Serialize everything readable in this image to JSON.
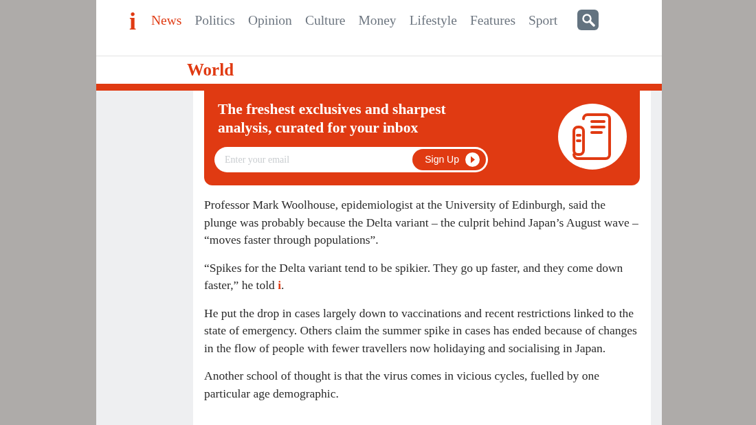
{
  "logo": "i",
  "nav": [
    {
      "label": "News",
      "selected": true
    },
    {
      "label": "Politics",
      "selected": false
    },
    {
      "label": "Opinion",
      "selected": false
    },
    {
      "label": "Culture",
      "selected": false
    },
    {
      "label": "Money",
      "selected": false
    },
    {
      "label": "Lifestyle",
      "selected": false
    },
    {
      "label": "Features",
      "selected": false
    },
    {
      "label": "Sport",
      "selected": false
    }
  ],
  "section": "World",
  "promo": {
    "headline": "The freshest exclusives and sharpest analysis, curated for your inbox",
    "email": {
      "placeholder": "Enter your email"
    },
    "button": "Sign Up"
  },
  "paragraphs": [
    "Professor Mark Woolhouse, epidemiologist at the University of Edinburgh, said the plunge was probably because the Delta variant – the culprit behind Japan’s August wave – “moves faster through populations”.",
    "“Spikes for the Delta variant tend to be spikier. They go up faster, and they come down faster,” he told **i**.",
    "He put the drop in cases largely down to vaccinations and recent restrictions linked to the state of emergency. Others claim the summer spike in cases has ended because of changes in the flow of people with fewer travellers now holidaying and socialising in Japan.",
    "Another school of thought is that the virus comes in vicious cycles, fuelled by one particular age demographic."
  ]
}
